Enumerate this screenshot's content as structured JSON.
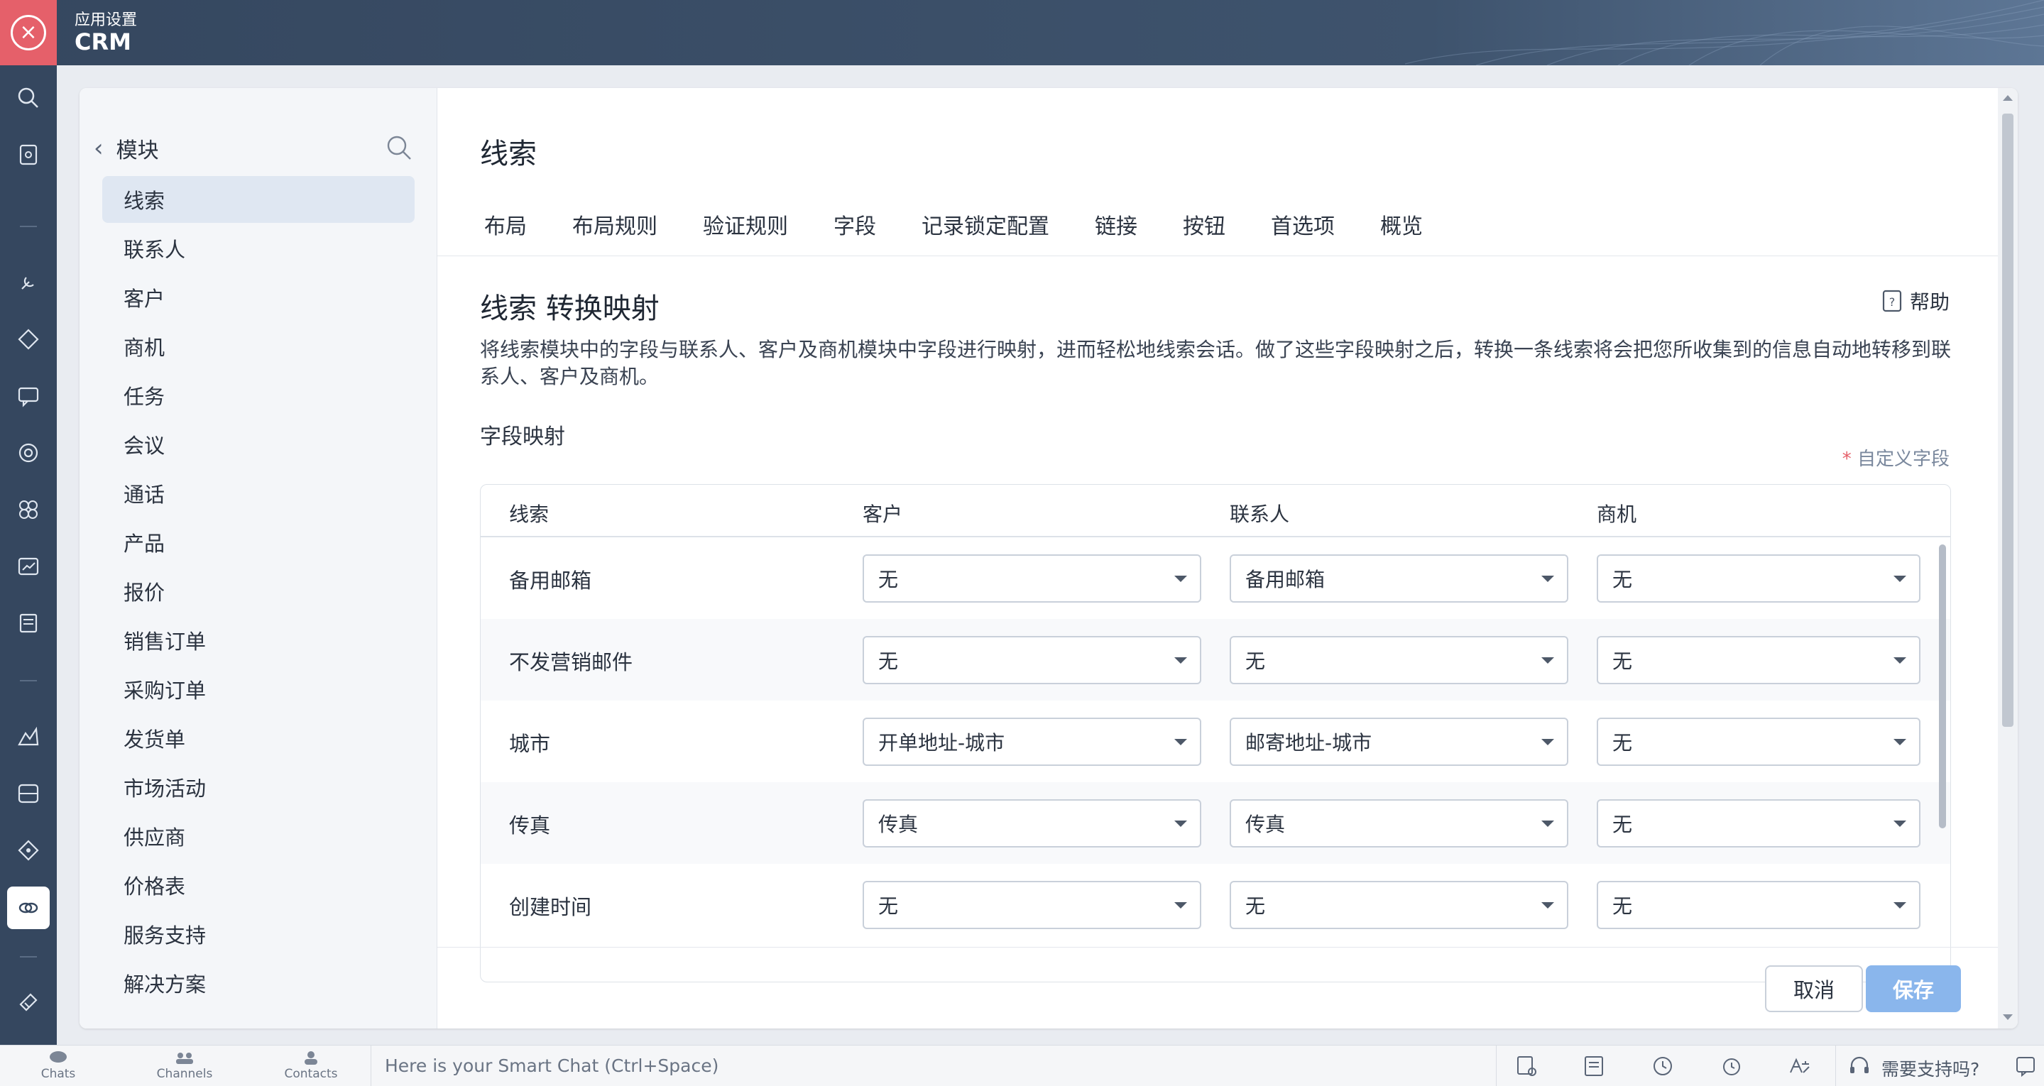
{
  "header": {
    "subtitle": "应用设置",
    "title": "CRM"
  },
  "sidebar": {
    "title": "模块",
    "items": [
      {
        "label": "线索",
        "active": true
      },
      {
        "label": "联系人"
      },
      {
        "label": "客户"
      },
      {
        "label": "商机"
      },
      {
        "label": "任务"
      },
      {
        "label": "会议"
      },
      {
        "label": "通话"
      },
      {
        "label": "产品"
      },
      {
        "label": "报价"
      },
      {
        "label": "销售订单"
      },
      {
        "label": "采购订单"
      },
      {
        "label": "发货单"
      },
      {
        "label": "市场活动"
      },
      {
        "label": "供应商"
      },
      {
        "label": "价格表"
      },
      {
        "label": "服务支持"
      },
      {
        "label": "解决方案"
      }
    ]
  },
  "main": {
    "module_title": "线索",
    "tabs": [
      "布局",
      "布局规则",
      "验证规则",
      "字段",
      "记录锁定配置",
      "链接",
      "按钮",
      "首选项",
      "概览"
    ],
    "section_title": "线索 转换映射",
    "help_label": "帮助",
    "description": "将线索模块中的字段与联系人、客户及商机模块中字段进行映射，进而轻松地线索会话。做了这些字段映射之后，转换一条线索将会把您所收集到的信息自动地转移到联系人、客户及商机。",
    "subsection_title": "字段映射",
    "custom_field_note": "自定义字段",
    "table": {
      "headers": [
        "线索",
        "客户",
        "联系人",
        "商机"
      ],
      "rows": [
        {
          "field": "备用邮箱",
          "account": "无",
          "contact": "备用邮箱",
          "deal": "无"
        },
        {
          "field": "不发营销邮件",
          "account": "无",
          "contact": "无",
          "deal": "无"
        },
        {
          "field": "城市",
          "account": "开单地址-城市",
          "contact": "邮寄地址-城市",
          "deal": "无"
        },
        {
          "field": "传真",
          "account": "传真",
          "contact": "传真",
          "deal": "无"
        },
        {
          "field": "创建时间",
          "account": "无",
          "contact": "无",
          "deal": "无"
        }
      ]
    },
    "cancel_label": "取消",
    "save_label": "保存"
  },
  "bottombar": {
    "chats": "Chats",
    "channels": "Channels",
    "contacts": "Contacts",
    "smart_chat_placeholder": "Here is your Smart Chat (Ctrl+Space)",
    "support_label": "需要支持吗?"
  },
  "colors": {
    "header_bg": "#3e536d",
    "close_btn": "#e5606a",
    "active_item_bg": "#dfe7f2",
    "save_button": "#8ab6ec"
  }
}
